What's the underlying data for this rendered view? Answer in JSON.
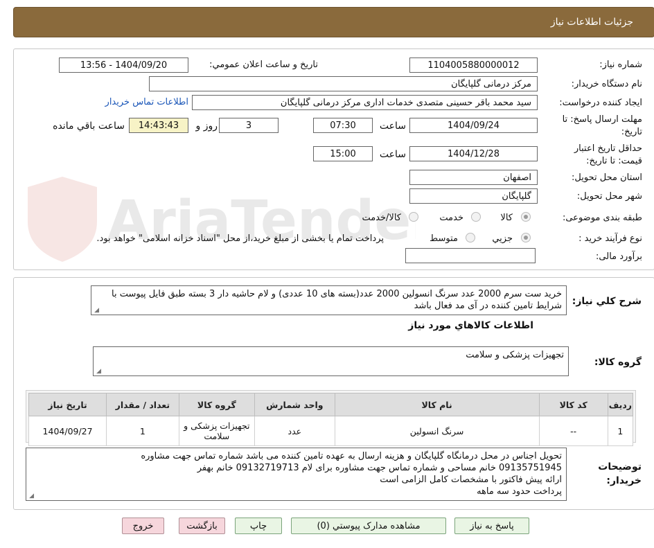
{
  "header": {
    "title": "جزئیات اطلاعات نیاز"
  },
  "form": {
    "need_number_label": "شماره نیاز:",
    "need_number": "1104005880000012",
    "announce_label": "تاریخ و ساعت اعلان عمومي:",
    "announce_value": "1404/09/20 - 13:56",
    "buyer_org_label": "نام دستگاه خریدار:",
    "buyer_org": "مرکز درمانی گلپایگان",
    "creator_label": "ایجاد کننده درخواست:",
    "creator": "سید محمد باقر حسینی متصدی خدمات اداری مرکز درمانی گلپایگان",
    "contact_link": "اطلاعات تماس خریدار",
    "deadline_label_1": "مهلت ارسال پاسخ: تا",
    "deadline_label_2": "تاریخ:",
    "deadline_date": "1404/09/24",
    "time_label": "ساعت",
    "deadline_time": "07:30",
    "days_value": "3",
    "days_label": "روز و",
    "remaining_time": "14:43:43",
    "remaining_label": "ساعت باقي مانده",
    "validity_label_1": "حداقل تاریخ اعتبار",
    "validity_label_2": "قیمت: تا تاریخ:",
    "validity_date": "1404/12/28",
    "validity_time": "15:00",
    "province_label": "استان محل تحویل:",
    "province": "اصفهان",
    "city_label": "شهر محل تحویل:",
    "city": "گلپایگان",
    "category_label": "طبقه بندی موضوعی:",
    "category_options": [
      "کالا",
      "خدمت",
      "کالا/خدمت"
    ],
    "process_label": "نوع فرآیند خرید :",
    "process_options": [
      "جزیي",
      "متوسط"
    ],
    "process_note": "پرداخت تمام یا بخشی از مبلغ خرید،از محل \"اسناد خزانه اسلامی\" خواهد بود.",
    "estimate_label": "برآورد مالی:",
    "estimate_value": ""
  },
  "description": {
    "label": "شرح کلي نياز:",
    "text": "خرید ست سرم 2000 عدد سرنگ انسولین 2000 عدد(بسته های 10 عددی) و لام حاشیه دار 3 بسته طبق فایل پیوست با شرایط تامین کننده در آی مد فعال باشد"
  },
  "goods": {
    "section_title": "اطلاعات كالاهاي مورد نياز",
    "group_label": "گروه کالا:",
    "group_value": "تجهیزات پزشکی و سلامت",
    "columns": [
      "رديف",
      "کد کالا",
      "نام کالا",
      "واحد شمارش",
      "گروه کالا",
      "تعداد / مقدار",
      "تاریخ نیاز"
    ],
    "rows": [
      {
        "row": "1",
        "code": "--",
        "name": "سرنگ انسولین",
        "unit": "عدد",
        "group": "تجهیزات پزشکی و سلامت",
        "qty": "1",
        "date": "1404/09/27"
      }
    ]
  },
  "buyer_notes": {
    "label_1": "توضیحات",
    "label_2": "خریدار:",
    "lines": [
      "تحویل اجناس در محل درمانگاه گلپایگان و هزینه ارسال به عهده تامین کننده می باشد شماره تماس جهت مشاوره",
      "09135751945 خانم مساحی و شماره تماس جهت مشاوره برای لام 09132719713 خانم بهفر",
      "ارائه پیش فاکتور با مشخصات کامل الزامی است",
      "پرداخت حدود سه ماهه"
    ]
  },
  "buttons": {
    "reply": "پاسخ به نیاز",
    "attachments": "مشاهده مدارک پیوستي (0)",
    "print": "چاپ",
    "back": "بازگشت",
    "exit": "خروج"
  },
  "watermark": {
    "text": "AriaTender.neT"
  }
}
